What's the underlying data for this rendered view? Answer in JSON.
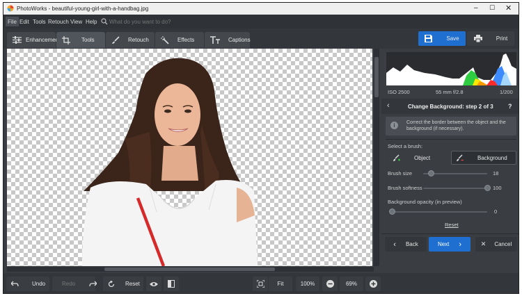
{
  "app": {
    "title": "PhotoWorks - beautiful-young-girl-with-a-handbag.jpg"
  },
  "menu": {
    "items": [
      "File",
      "Edit",
      "Tools",
      "Retouch",
      "View",
      "Help"
    ],
    "search_placeholder": "What do you want to do?"
  },
  "tabs": [
    {
      "label": "Enhancement",
      "icon": "sliders-icon"
    },
    {
      "label": "Tools",
      "icon": "crop-icon"
    },
    {
      "label": "Retouch",
      "icon": "brush-icon"
    },
    {
      "label": "Effects",
      "icon": "magic-wand-icon"
    },
    {
      "label": "Captions",
      "icon": "text-icon"
    }
  ],
  "actions": {
    "save": "Save",
    "print": "Print"
  },
  "photo_info": {
    "iso": "ISO 2500",
    "lens": "55 mm f/2.8",
    "shutter": "1/200"
  },
  "wizard": {
    "title": "Change Background: step 2 of 3",
    "help": "?",
    "info_text": "Correct the border between the object and the background (if necessary).",
    "select_brush_label": "Select a brush:",
    "brush_object": "Object",
    "brush_background": "Background",
    "brush_size_label": "Brush size",
    "brush_size_value": "18",
    "brush_size_level": 0.12,
    "brush_softness_label": "Brush softness",
    "brush_softness_value": "100",
    "brush_softness_level": 1.0,
    "bg_opacity_label": "Background opacity (in preview)",
    "bg_opacity_value": "0",
    "bg_opacity_level": 0.0,
    "reset_link": "Reset",
    "back": "Back",
    "next": "Next",
    "cancel": "Cancel"
  },
  "bottom": {
    "undo": "Undo",
    "redo": "Redo",
    "reset": "Reset",
    "fit": "Fit",
    "zoom_100": "100%",
    "zoom_value": "69%"
  },
  "colors": {
    "accent": "#1e6fd0",
    "background": "#3a3d42",
    "panel_dark": "#2d3034"
  }
}
